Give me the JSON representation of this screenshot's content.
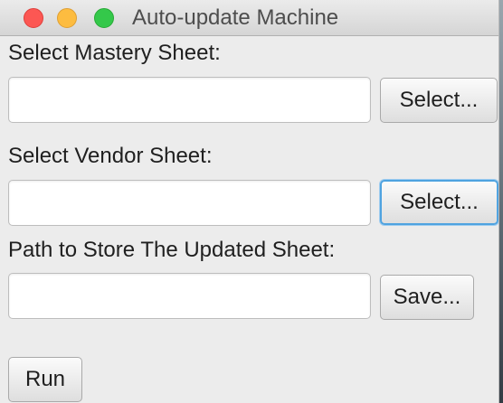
{
  "window": {
    "title": "Auto-update Machine"
  },
  "mastery": {
    "label": "Select Mastery Sheet:",
    "value": "",
    "button_label": "Select..."
  },
  "vendor": {
    "label": "Select Vendor Sheet:",
    "value": "",
    "button_label": "Select..."
  },
  "output": {
    "label": "Path to Store The Updated Sheet:",
    "value": "",
    "button_label": "Save..."
  },
  "run": {
    "label": "Run"
  },
  "colors": {
    "close": "#fc5753",
    "minimize": "#fdbc40",
    "zoom": "#34c84a",
    "focus_ring": "#4fa3e0"
  }
}
